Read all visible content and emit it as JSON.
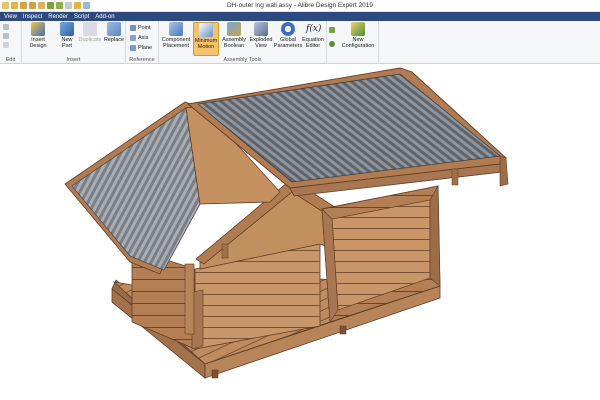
{
  "window": {
    "title": "DH-outer lng wall assy - Alibre Design Expert 2019"
  },
  "menu": [
    "View",
    "Inspect",
    "Render",
    "Script",
    "Add-on"
  ],
  "ribbon": {
    "groups": {
      "edit": "Edit",
      "insert": "Insert",
      "reference": "Reference",
      "assembly_tools": "Assembly Tools"
    },
    "tools": {
      "insert_design": "Insert Design",
      "new_part": "New Part",
      "duplicate": "Duplicate",
      "replace": "Replace",
      "point": "Point",
      "axis": "Axis",
      "plane": "Plane",
      "component_placement": "Component Placement",
      "minimum_motion": "Minimum Motion",
      "assembly_boolean": "Assembly Boolean",
      "exploded_view": "Exploded View",
      "global_parameters": "Global Parameters",
      "equation_editor": "Equation Editor",
      "new_configuration": "New Configuration"
    },
    "equation_glyph": "f(x)"
  },
  "colors": {
    "menu_bg": "#2d4a80",
    "ribbon_bg": "#f5f6f8",
    "active_tool": "#f4c36a",
    "wood": "#c79466",
    "wood_dark": "#a87650",
    "roof_metal": "#6f747a"
  },
  "icons": {
    "insert_design": "insert-design-icon",
    "new_part": "new-part-icon",
    "duplicate": "duplicate-icon",
    "replace": "replace-icon",
    "global_parameters": "global-parameters-icon",
    "equation_editor": "equation-editor-icon"
  }
}
